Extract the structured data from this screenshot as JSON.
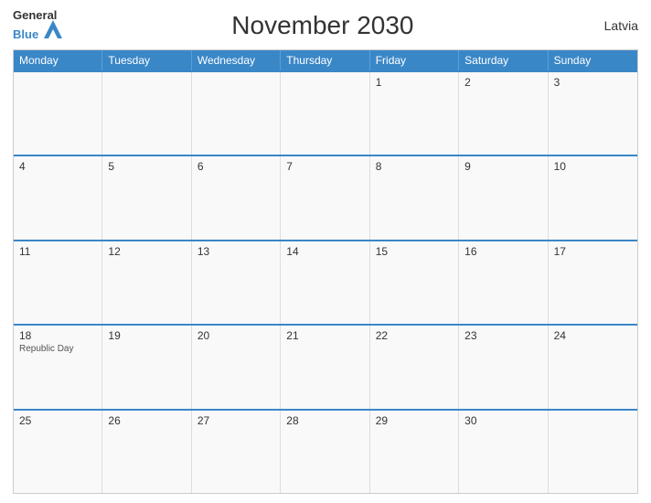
{
  "header": {
    "logo_line1": "General",
    "logo_line2": "Blue",
    "title": "November 2030",
    "country": "Latvia"
  },
  "weekdays": [
    "Monday",
    "Tuesday",
    "Wednesday",
    "Thursday",
    "Friday",
    "Saturday",
    "Sunday"
  ],
  "weeks": [
    [
      {
        "day": "",
        "event": ""
      },
      {
        "day": "",
        "event": ""
      },
      {
        "day": "",
        "event": ""
      },
      {
        "day": "",
        "event": ""
      },
      {
        "day": "1",
        "event": ""
      },
      {
        "day": "2",
        "event": ""
      },
      {
        "day": "3",
        "event": ""
      }
    ],
    [
      {
        "day": "4",
        "event": ""
      },
      {
        "day": "5",
        "event": ""
      },
      {
        "day": "6",
        "event": ""
      },
      {
        "day": "7",
        "event": ""
      },
      {
        "day": "8",
        "event": ""
      },
      {
        "day": "9",
        "event": ""
      },
      {
        "day": "10",
        "event": ""
      }
    ],
    [
      {
        "day": "11",
        "event": ""
      },
      {
        "day": "12",
        "event": ""
      },
      {
        "day": "13",
        "event": ""
      },
      {
        "day": "14",
        "event": ""
      },
      {
        "day": "15",
        "event": ""
      },
      {
        "day": "16",
        "event": ""
      },
      {
        "day": "17",
        "event": ""
      }
    ],
    [
      {
        "day": "18",
        "event": "Republic Day"
      },
      {
        "day": "19",
        "event": ""
      },
      {
        "day": "20",
        "event": ""
      },
      {
        "day": "21",
        "event": ""
      },
      {
        "day": "22",
        "event": ""
      },
      {
        "day": "23",
        "event": ""
      },
      {
        "day": "24",
        "event": ""
      }
    ],
    [
      {
        "day": "25",
        "event": ""
      },
      {
        "day": "26",
        "event": ""
      },
      {
        "day": "27",
        "event": ""
      },
      {
        "day": "28",
        "event": ""
      },
      {
        "day": "29",
        "event": ""
      },
      {
        "day": "30",
        "event": ""
      },
      {
        "day": "",
        "event": ""
      }
    ]
  ]
}
